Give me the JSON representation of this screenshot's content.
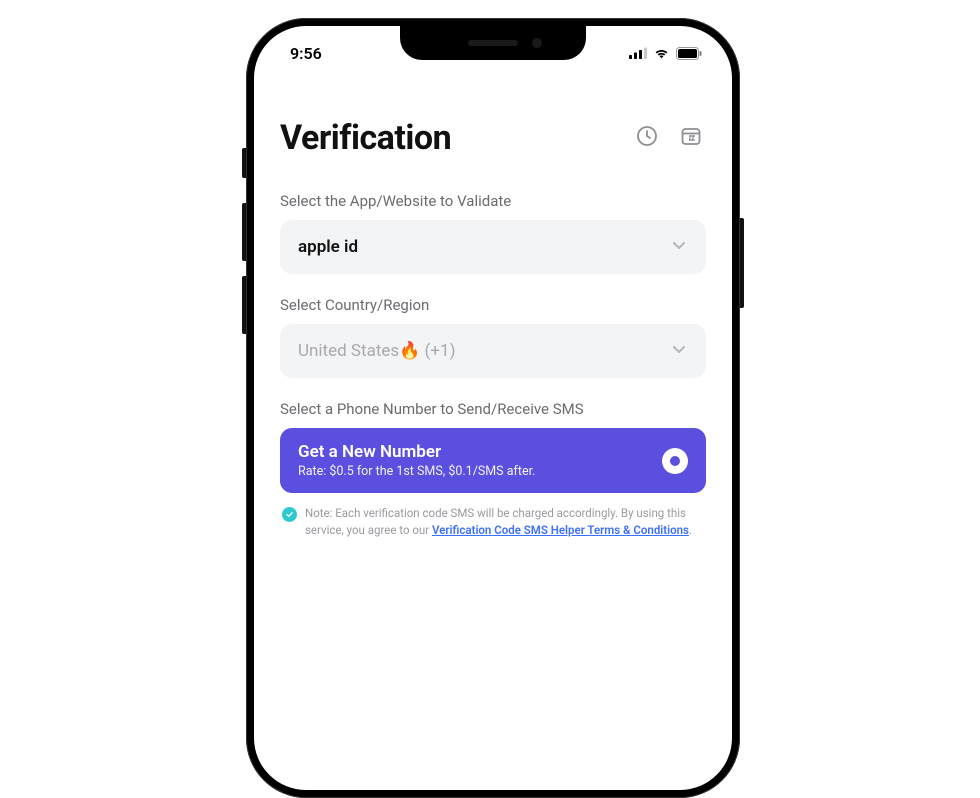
{
  "status": {
    "time": "9:56"
  },
  "header": {
    "title": "Verification"
  },
  "sections": {
    "app_label": "Select the App/Website to Validate",
    "app_value": "apple id",
    "country_label": "Select Country/Region",
    "country_value": "United States🔥 (+1)",
    "phone_label": "Select a Phone Number to Send/Receive SMS"
  },
  "cta": {
    "title": "Get a New Number",
    "subtitle": "Rate: $0.5 for the 1st SMS, $0.1/SMS after."
  },
  "note": {
    "prefix": "Note: Each verification code SMS will be charged accordingly. By using this service, you agree to our ",
    "link": "Verification Code SMS Helper Terms & Conditions",
    "suffix": "."
  }
}
